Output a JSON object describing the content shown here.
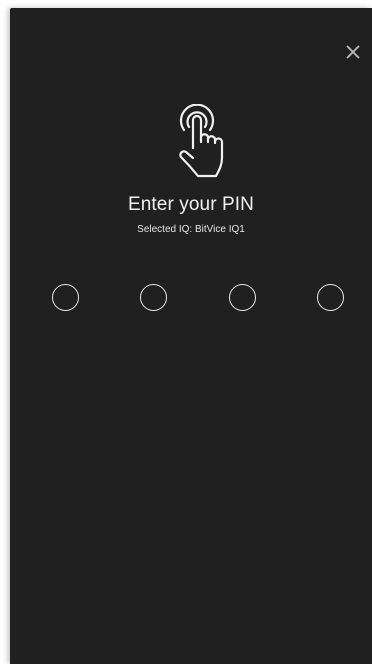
{
  "screen": {
    "background_color": "#202020",
    "icon": "touch-finger-icon",
    "close_icon": "close-icon"
  },
  "title": "Enter your PIN",
  "subtitle": "Selected IQ: BitVice IQ1",
  "pin": {
    "length": 4,
    "filled": 0
  }
}
